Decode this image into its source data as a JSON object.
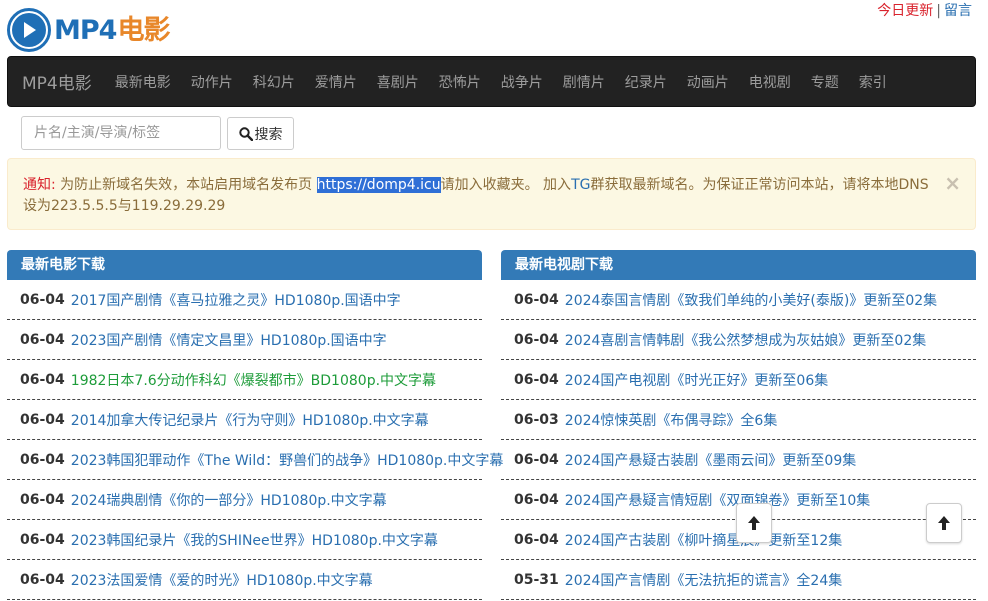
{
  "logo": {
    "mp4": "MP4",
    "cn": "电影"
  },
  "top_links": {
    "update": "今日更新",
    "sep": "|",
    "message": "留言"
  },
  "nav": {
    "brand": "MP4电影",
    "items": [
      "最新电影",
      "动作片",
      "科幻片",
      "爱情片",
      "喜剧片",
      "恐怖片",
      "战争片",
      "剧情片",
      "纪录片",
      "动画片",
      "电视剧",
      "专题",
      "索引"
    ]
  },
  "search": {
    "placeholder": "片名/主演/导演/标签",
    "button": "搜索"
  },
  "alert": {
    "label": "通知:",
    "text1": " 为防止新域名失效，本站启用域名发布页 ",
    "url": "https://domp4.icu",
    "text2": "请加入收藏夹。 加入",
    "tg": "TG",
    "text3": "群获取最新域名。为保证正常访问本站，请将本地DNS设为223.5.5.5与119.29.29.29",
    "close": "×"
  },
  "movies": {
    "title": "最新电影下载",
    "rows": [
      {
        "date": "06-04",
        "title": "2017国产剧情《喜马拉雅之灵》HD1080p.国语中字"
      },
      {
        "date": "06-04",
        "title": "2023国产剧情《情定文昌里》HD1080p.国语中字"
      },
      {
        "date": "06-04",
        "title": "1982日本7.6分动作科幻《爆裂都市》BD1080p.中文字幕",
        "green": true
      },
      {
        "date": "06-04",
        "title": "2014加拿大传记纪录片《行为守则》HD1080p.中文字幕"
      },
      {
        "date": "06-04",
        "title": "2023韩国犯罪动作《The Wild：野兽们的战争》HD1080p.中文字幕"
      },
      {
        "date": "06-04",
        "title": "2024瑞典剧情《你的一部分》HD1080p.中文字幕"
      },
      {
        "date": "06-04",
        "title": "2023韩国纪录片《我的SHINee世界》HD1080p.中文字幕"
      },
      {
        "date": "06-04",
        "title": "2023法国爱情《爱的时光》HD1080p.中文字幕"
      }
    ]
  },
  "tv": {
    "title": "最新电视剧下载",
    "rows": [
      {
        "date": "06-04",
        "title": "2024泰国言情剧《致我们单纯的小美好(泰版)》更新至02集"
      },
      {
        "date": "06-04",
        "title": "2024喜剧言情韩剧《我公然梦想成为灰姑娘》更新至02集"
      },
      {
        "date": "06-04",
        "title": "2024国产电视剧《时光正好》更新至06集"
      },
      {
        "date": "06-03",
        "title": "2024惊悚英剧《布偶寻踪》全6集"
      },
      {
        "date": "06-04",
        "title": "2024国产悬疑古装剧《墨雨云间》更新至09集"
      },
      {
        "date": "06-04",
        "title": "2024国产悬疑言情短剧《双面锦卷》更新至10集"
      },
      {
        "date": "06-04",
        "title": "2024国产古装剧《柳叶摘星辰》更新至12集"
      },
      {
        "date": "05-31",
        "title": "2024国产言情剧《无法抗拒的谎言》全24集"
      }
    ]
  },
  "colors": {
    "accent": "#337ab7",
    "navbar": "#222222",
    "alert_bg": "#fcf8e3",
    "link": "#2a6fb0",
    "green": "#1e9c3a",
    "red": "#d9232d"
  }
}
